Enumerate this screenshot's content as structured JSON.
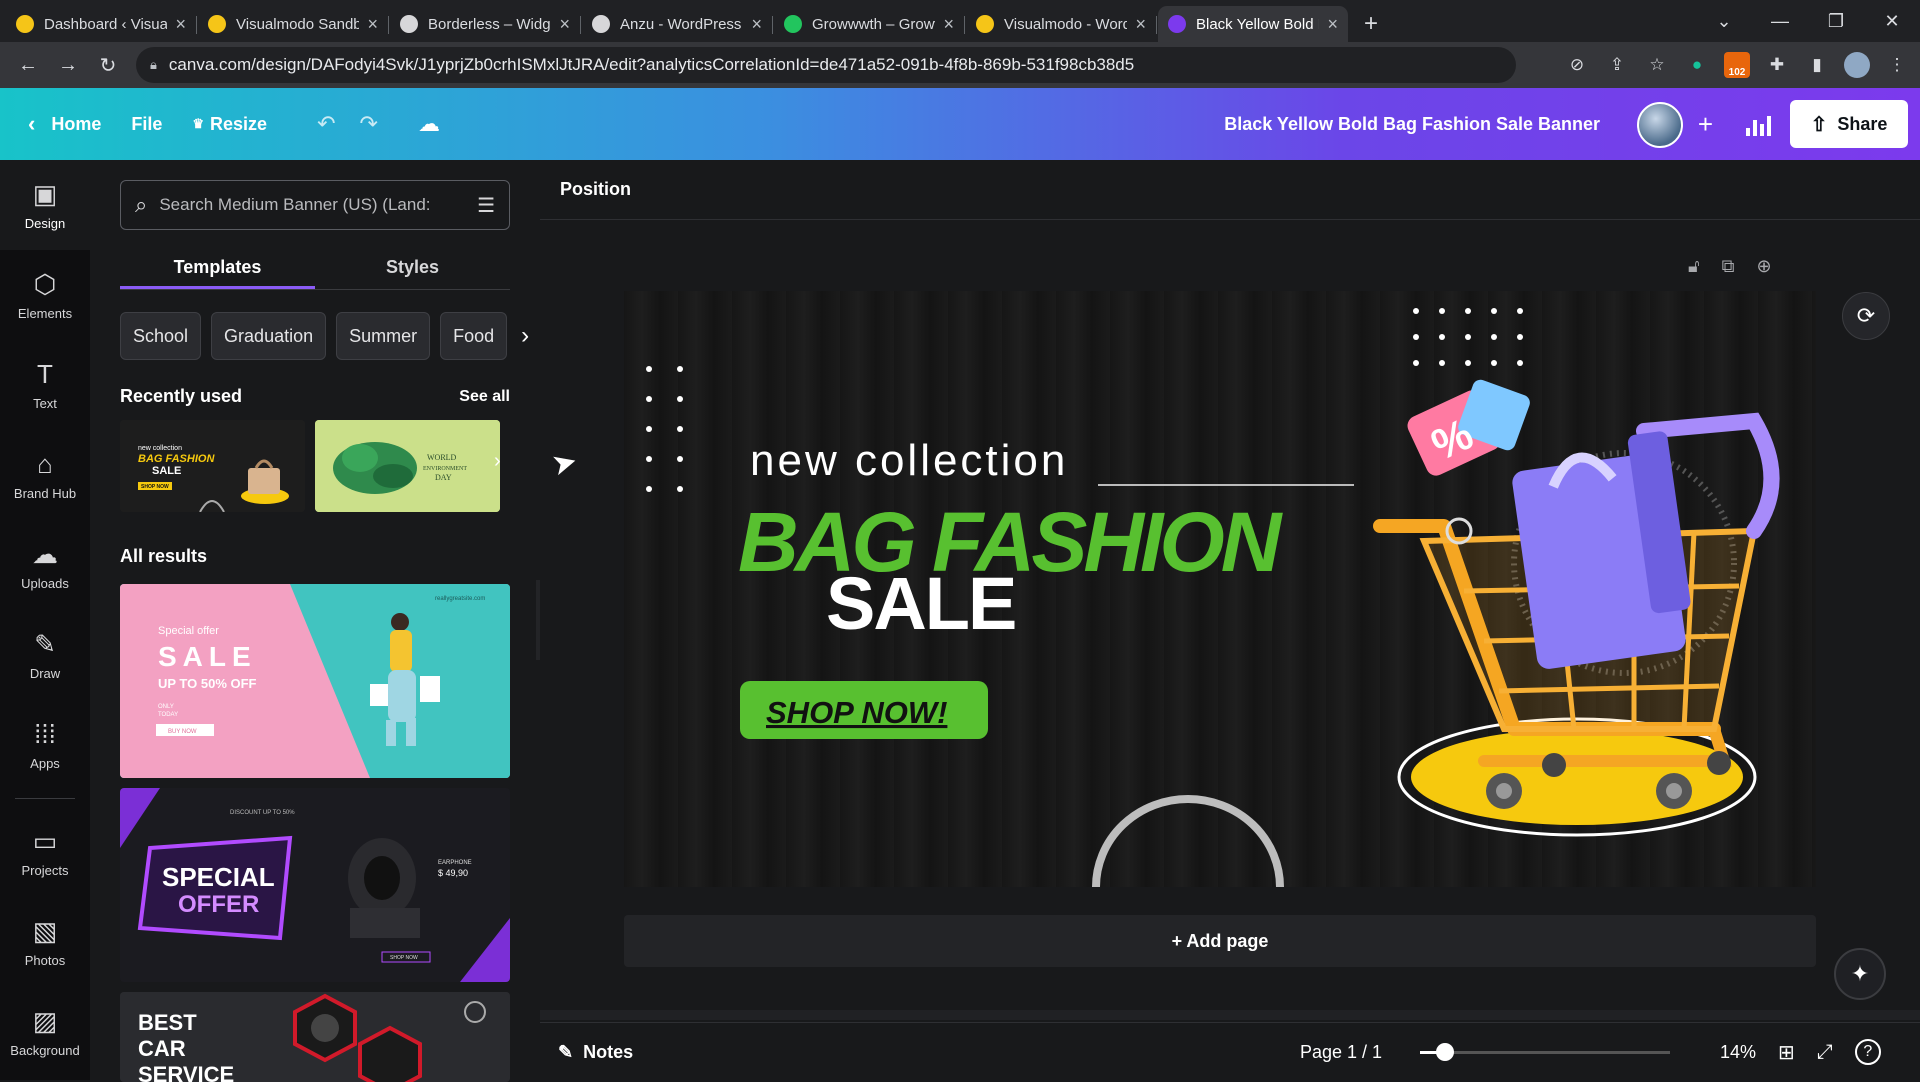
{
  "browser": {
    "tabs": [
      {
        "title": "Dashboard ‹ Visualmo",
        "icon": "visualmodo-icon",
        "color": "#f5c518"
      },
      {
        "title": "Visualmodo Sandbox",
        "icon": "visualmodo-icon",
        "color": "#f5c518"
      },
      {
        "title": "Borderless – Widgets,",
        "icon": "wordpress-icon",
        "color": "#d7d7d9"
      },
      {
        "title": "Anzu - WordPress the",
        "icon": "wordpress-icon",
        "color": "#d7d7d9"
      },
      {
        "title": "Growwwth – Growww",
        "icon": "growwwth-icon",
        "color": "#22c55e"
      },
      {
        "title": "Visualmodo - WordPr",
        "icon": "visualmodo-icon",
        "color": "#f5c518"
      },
      {
        "title": "Black Yellow Bold Bag",
        "icon": "canva-icon",
        "color": "#7c3aed",
        "active": true
      }
    ],
    "url": "canva.com/design/DAFodyi4Svk/J1yprjZb0crhISMxlJtJRA/edit?analyticsCorrelationId=de471a52-091b-4f8b-869b-531f98cb38d5",
    "extension_badge": "102"
  },
  "header": {
    "home": "Home",
    "file": "File",
    "resize": "Resize",
    "title": "Black Yellow Bold Bag Fashion Sale Banner",
    "share": "Share"
  },
  "rail": [
    {
      "label": "Design",
      "icon": "design-icon",
      "glyph": "▣",
      "active": true
    },
    {
      "label": "Elements",
      "icon": "elements-icon",
      "glyph": "⬡"
    },
    {
      "label": "Text",
      "icon": "text-icon",
      "glyph": "T"
    },
    {
      "label": "Brand Hub",
      "icon": "brand-hub-icon",
      "glyph": "⌂"
    },
    {
      "label": "Uploads",
      "icon": "uploads-icon",
      "glyph": "☁"
    },
    {
      "label": "Draw",
      "icon": "draw-icon",
      "glyph": "✎"
    },
    {
      "label": "Apps",
      "icon": "apps-icon",
      "glyph": "⁞⁞⁞"
    },
    {
      "label": "Projects",
      "icon": "projects-icon",
      "glyph": "▭"
    },
    {
      "label": "Photos",
      "icon": "photos-icon",
      "glyph": "▧"
    },
    {
      "label": "Background",
      "icon": "background-icon",
      "glyph": "▨"
    }
  ],
  "panel": {
    "search_placeholder": "Search Medium Banner (US) (Land:",
    "tabs": [
      "Templates",
      "Styles"
    ],
    "chips": [
      "School",
      "Graduation",
      "Summer",
      "Food"
    ],
    "recently_used": "Recently used",
    "see_all": "See all",
    "all_results": "All results",
    "thumb1": {
      "kicker": "new collection",
      "title": "BAG FASHION",
      "sub": "SALE",
      "btn": "SHOP NOW"
    },
    "thumb2": {
      "line1": "WORLD",
      "line2": "ENVIRONMENT",
      "line3": "DAY"
    },
    "tpl1": {
      "kicker": "Special offer",
      "title": "SALE",
      "sub": "UP TO 50% OFF",
      "small1": "ONLY",
      "small2": "TODAY",
      "btn": "BUY NOW",
      "site": "reallygreatsite.com"
    },
    "tpl2": {
      "kicker": "DISCOUNT UP TO 50%",
      "line1": "SPECIAL",
      "line2": "OFFER",
      "label": "EARPHONE",
      "price": "$ 49,90",
      "btn": "SHOP NOW"
    },
    "tpl3": {
      "line1": "BEST",
      "line2": "CAR",
      "line3": "SERVICE"
    }
  },
  "workspace": {
    "position": "Position",
    "add_page": "+ Add page",
    "notes": "Notes",
    "page": "Page 1 / 1",
    "zoom": "14%",
    "zoom_fraction": 0.1
  },
  "design": {
    "kicker": "new collection",
    "headline": "BAG FASHION",
    "sale": "SALE",
    "cta": "SHOP NOW!",
    "tag_symbol": "%",
    "colors": {
      "green": "#58c030",
      "yellow": "#f6c90e",
      "bg": "#1a1a1a"
    }
  }
}
